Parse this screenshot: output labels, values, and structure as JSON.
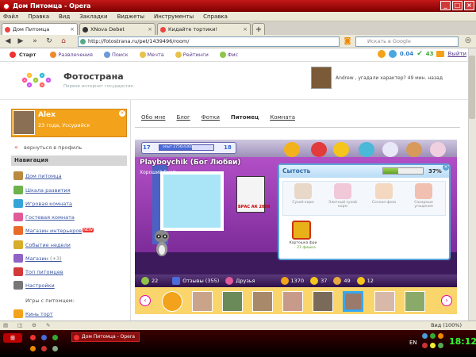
{
  "window": {
    "title": "Дом Питомца - Opera"
  },
  "menu": [
    "Файл",
    "Правка",
    "Вид",
    "Закладки",
    "Виджеты",
    "Инструменты",
    "Справка"
  ],
  "tabs": [
    {
      "label": "Дом Питомца",
      "active": true
    },
    {
      "label": "XNova Debet",
      "active": false
    },
    {
      "label": "Кидайте тортики!",
      "active": false
    }
  ],
  "address": {
    "url": "http://fotostrana.ru/pet/1439496/room/",
    "search_placeholder": "Искать в Google"
  },
  "fsbar": {
    "start": "Старт",
    "items": [
      "Развлечения",
      "Поиск",
      "Мечта",
      "Рейтинги",
      "Фис"
    ],
    "coins": "0.04",
    "points": "43",
    "exit": "Выйти"
  },
  "site": {
    "logo": "Фотострана",
    "tagline": "Первое интернет государство",
    "promo": "Andrew , угадали характер? 49 мин. назад"
  },
  "user": {
    "name": "Alex",
    "info": "23 года, Уссурийск"
  },
  "sidebar": {
    "back": "вернуться в профиль",
    "nav_title": "Навигация",
    "items": [
      {
        "label": "Дом питомца",
        "badge": "",
        "color": "#b98a3f"
      },
      {
        "label": "Шкала развития",
        "badge": "",
        "color": "#6db24a"
      },
      {
        "label": "Игровая комната",
        "badge": "",
        "color": "#35a4d8"
      },
      {
        "label": "Гостевая комната",
        "badge": "",
        "color": "#e05a9a"
      },
      {
        "label": "Магазин интерьеров",
        "badge": "NEW",
        "color": "#e86b2a"
      },
      {
        "label": "Событие недели",
        "badge": "",
        "color": "#d8ad2a"
      },
      {
        "label": "Магазин",
        "badge": "(+3)",
        "color": "#8f64c4"
      },
      {
        "label": "Топ питомцев",
        "badge": "",
        "color": "#d23a3a"
      },
      {
        "label": "Настройки",
        "badge": "",
        "color": "#777777"
      }
    ],
    "games_title": "Игры с питомцем:",
    "game_item": "Кинь торт"
  },
  "main": {
    "tabs": [
      "Обо мне",
      "Блог",
      "Фотки",
      "Питомец",
      "Комната"
    ],
    "current_tab": "Питомец"
  },
  "game": {
    "level": "17",
    "next_level": "18",
    "xp_text": "опыт 2756/4360",
    "xp_progress": 0.6,
    "pet_name": "Playboychik (Бог Любви)",
    "pet_sub": "Хороший Енот",
    "poster_text": "БРАС АК 2008",
    "popup": {
      "title": "Сытость",
      "percent": "37%",
      "satiety": 0.37,
      "foods": [
        "Сухой корм",
        "Элитный сухой корм",
        "Сочная фаза",
        "Сахарные угощения"
      ],
      "fries_label": "Картошка фри",
      "fries_count": "21 фишка"
    },
    "status": {
      "likes": "22",
      "reviews": "Отзывы (355)",
      "friends": "Друзья",
      "n1": "1370",
      "n2": "37",
      "n3": "49",
      "n4": "12"
    }
  },
  "browser": {
    "zoom": "Вид (100%)"
  },
  "taskbar": {
    "task": "Дом Питомца - Opera",
    "lang": "EN",
    "clock": "18:12"
  }
}
